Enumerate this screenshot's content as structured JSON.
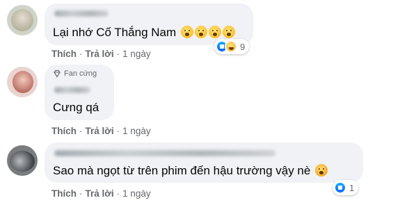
{
  "comments": [
    {
      "text": "Lại nhớ Cố Thắng Nam",
      "actions": {
        "like": "Thích",
        "reply": "Trả lời",
        "time": "1 ngày"
      },
      "reactions": {
        "count": "9",
        "types": [
          "like-icon",
          "haha-icon"
        ]
      },
      "emoji_count": 4
    },
    {
      "badge": "Fan cứng",
      "text": "Cưng qá",
      "actions": {
        "like": "Thích",
        "reply": "Trả lời",
        "time": "1 ngày"
      }
    },
    {
      "text": "Sao mà ngọt từ trên phim đến hậu trường vậy nè",
      "actions": {
        "like": "Thích",
        "reply": "Trả lời",
        "time": "1 ngày"
      },
      "reactions": {
        "count": "1",
        "types": [
          "like-icon"
        ]
      }
    }
  ],
  "separator": "·",
  "colors": {
    "bubble": "#f0f2f5",
    "secondary_text": "#65676b",
    "like_blue": "#0866ff"
  }
}
